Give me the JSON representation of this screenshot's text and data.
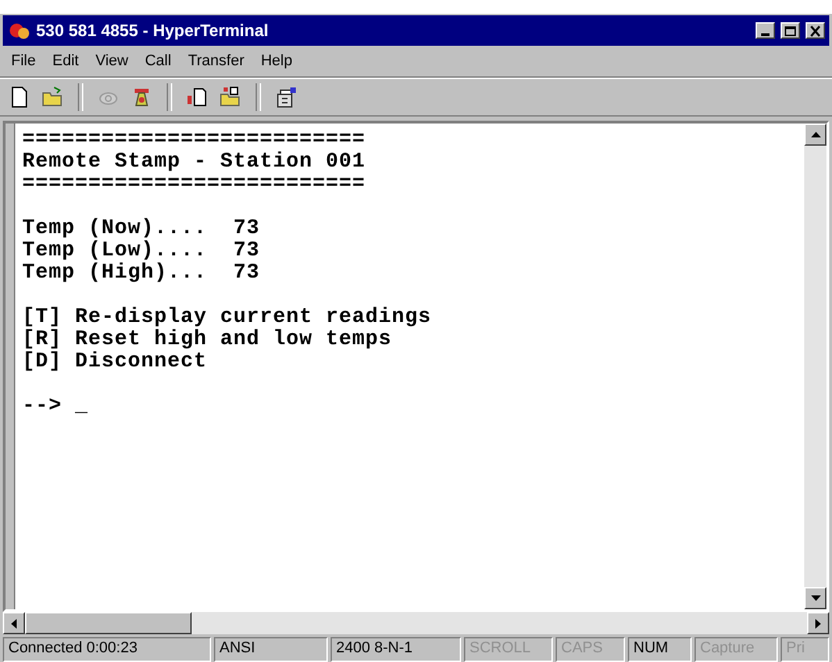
{
  "window": {
    "title": "530 581 4855 - HyperTerminal"
  },
  "menu": [
    {
      "label": "File"
    },
    {
      "label": "Edit"
    },
    {
      "label": "View"
    },
    {
      "label": "Call"
    },
    {
      "label": "Transfer"
    },
    {
      "label": "Help"
    }
  ],
  "toolbar": [
    {
      "kind": "new"
    },
    {
      "kind": "open"
    },
    {
      "kind": "sep"
    },
    {
      "kind": "disconnect"
    },
    {
      "kind": "dial"
    },
    {
      "kind": "sep"
    },
    {
      "kind": "send"
    },
    {
      "kind": "receive"
    },
    {
      "kind": "sep"
    },
    {
      "kind": "properties"
    }
  ],
  "terminal": {
    "blocks": [
      [
        "==========================",
        "Remote Stamp - Station 001",
        "=========================="
      ],
      [
        "Temp (Now)....  73",
        "Temp (Low)....  73",
        "Temp (High)...  73"
      ],
      [
        "[T] Re-display current readings",
        "[R] Reset high and low temps",
        "[D] Disconnect"
      ]
    ],
    "prompt": "-->",
    "cursor": "_"
  },
  "status_bar": [
    {
      "text": "Connected 0:00:23",
      "disabled": false
    },
    {
      "text": "ANSI",
      "disabled": false
    },
    {
      "text": "2400 8-N-1",
      "disabled": false
    },
    {
      "text": "SCROLL",
      "disabled": true
    },
    {
      "text": "CAPS",
      "disabled": true
    },
    {
      "text": "NUM",
      "disabled": false
    },
    {
      "text": "Capture",
      "disabled": true
    },
    {
      "text": "Pri",
      "disabled": true
    }
  ]
}
